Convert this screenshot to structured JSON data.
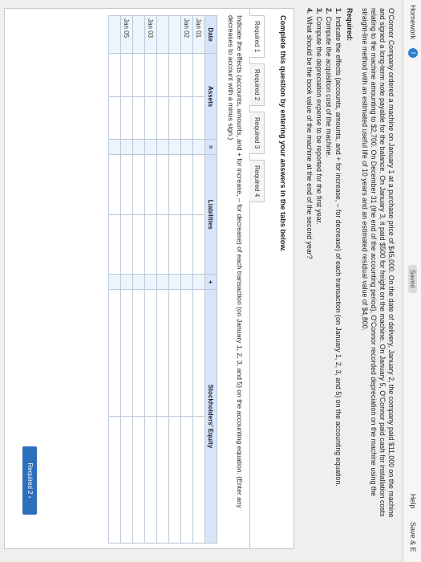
{
  "topbar": {
    "title": "Homework",
    "badge": "i",
    "saved": "Saved",
    "help": "Help",
    "save_exit": "Save & E"
  },
  "problem_text": "O'Connor Company ordered a machine on January 1 at a purchase price of $45,000. On the date of delivery, January 2, the company paid $11,000 on the machine and signed a long-term note payable for the balance. On January 3, it paid $500 for freight on the machine. On January 5, O'Connor paid cash for installation costs relating to the machine amounting to $2,700. On December 31 (the end of the accounting period), O'Connor recorded depreciation on the machine using the straight-line method with an estimated useful life of 10 years and an estimated residual value of $4,800.",
  "required_title": "Required:",
  "required_items": [
    {
      "num": "1.",
      "text": "Indicate the effects (accounts, amounts, and + for increase, – for decrease) of each transaction (on January 1, 2, 3, and 5) on the accounting equation."
    },
    {
      "num": "2.",
      "text": "Compute the acquisition cost of the machine."
    },
    {
      "num": "3.",
      "text": "Compute the depreciation expense to be reported for the first year."
    },
    {
      "num": "4.",
      "text": "What should be the book value of the machine at the end of the second year?"
    }
  ],
  "complete_title": "Complete this question by entering your answers in the tabs below.",
  "tabs": [
    "Required 1",
    "Required 2",
    "Required 3",
    "Required 4"
  ],
  "instruction": "Indicate the effects (accounts, amounts, and + for increase, – for decrease) of each transaction (on January 1, 2, 3, and 5) on the accounting equation. (Enter any decreases to account with a minus sign.)",
  "table": {
    "headers": [
      "Date",
      "Assets",
      "=",
      "Liabilities",
      "+",
      "Stockholders' Equity"
    ],
    "dates": [
      "Jan 01",
      "Jan 02",
      "",
      "",
      "Jan 03",
      "",
      "Jan 05",
      ""
    ]
  },
  "nav_button": "Required 2  ›"
}
